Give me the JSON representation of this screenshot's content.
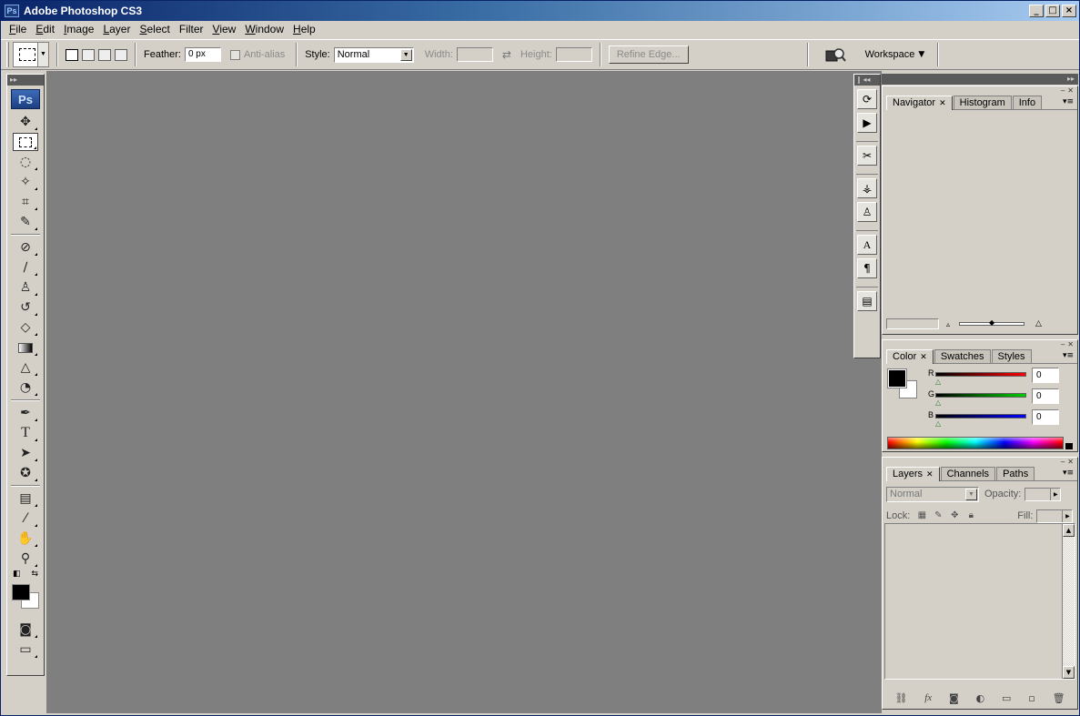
{
  "window": {
    "title": "Adobe Photoshop CS3",
    "icon": "Ps",
    "controls": [
      "_",
      "□",
      "×"
    ]
  },
  "menu": [
    {
      "label": "File",
      "u": "F",
      "rest": "ile"
    },
    {
      "label": "Edit",
      "u": "E",
      "rest": "dit"
    },
    {
      "label": "Image",
      "u": "I",
      "rest": "mage"
    },
    {
      "label": "Layer",
      "u": "L",
      "rest": "ayer"
    },
    {
      "label": "Select",
      "u": "S",
      "rest": "elect"
    },
    {
      "label": "Filter",
      "u": "F",
      "rest": "ilter"
    },
    {
      "label": "View",
      "u": "V",
      "rest": "iew"
    },
    {
      "label": "Window",
      "u": "W",
      "rest": "indow"
    },
    {
      "label": "Help",
      "u": "H",
      "rest": "elp"
    }
  ],
  "options": {
    "feather_label": "Feather:",
    "feather_value": "0 px",
    "antialias_label": "Anti-alias",
    "style_label": "Style:",
    "style_value": "Normal",
    "width_label": "Width:",
    "height_label": "Height:",
    "refine_edge": "Refine Edge...",
    "workspace": "Workspace",
    "bridge_label": "Br"
  },
  "tools_panel": {
    "logo": "Ps"
  },
  "navigator_panel": {
    "tabs": [
      "Navigator",
      "Histogram",
      "Info"
    ]
  },
  "color_panel": {
    "tabs": [
      "Color",
      "Swatches",
      "Styles"
    ],
    "channels": [
      {
        "name": "R",
        "value": "0",
        "color": "#ff0000"
      },
      {
        "name": "G",
        "value": "0",
        "color": "#00cc00"
      },
      {
        "name": "B",
        "value": "0",
        "color": "#0000ff"
      }
    ],
    "foreground": "#000000",
    "background": "#ffffff"
  },
  "layers_panel": {
    "tabs": [
      "Layers",
      "Channels",
      "Paths"
    ],
    "blend_mode": "Normal",
    "opacity_label": "Opacity:",
    "lock_label": "Lock:",
    "fill_label": "Fill:"
  },
  "canvas": {
    "background": "#7f7f7f"
  }
}
